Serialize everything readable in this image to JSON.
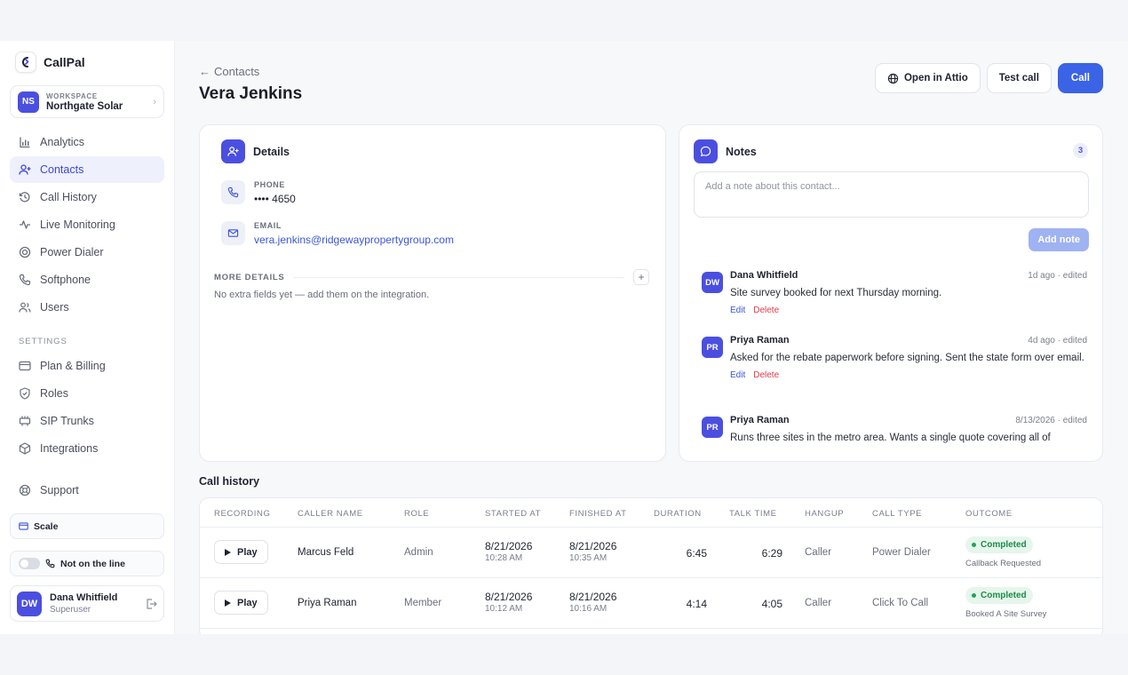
{
  "brand": {
    "name": "CallPal"
  },
  "workspace": {
    "badge": "NS",
    "label": "WORKSPACE",
    "name": "Northgate Solar"
  },
  "nav": [
    {
      "label": "Analytics",
      "icon": "bar-chart-icon"
    },
    {
      "label": "Contacts",
      "icon": "user-plus-icon",
      "active": true
    },
    {
      "label": "Call History",
      "icon": "history-icon"
    },
    {
      "label": "Live Monitoring",
      "icon": "activity-icon"
    },
    {
      "label": "Power Dialer",
      "icon": "target-icon"
    },
    {
      "label": "Softphone",
      "icon": "phone-icon"
    },
    {
      "label": "Users",
      "icon": "users-icon"
    }
  ],
  "settings_label": "SETTINGS",
  "settings_nav": [
    {
      "label": "Plan & Billing",
      "icon": "credit-card-icon"
    },
    {
      "label": "Roles",
      "icon": "shield-icon"
    },
    {
      "label": "SIP Trunks",
      "icon": "server-icon"
    },
    {
      "label": "Integrations",
      "icon": "cube-icon"
    }
  ],
  "support": {
    "label": "Support",
    "icon": "lifebuoy-icon"
  },
  "plan": {
    "label": "Scale"
  },
  "line_status": {
    "label": "Not on the line"
  },
  "user": {
    "initials": "DW",
    "name": "Dana Whitfield",
    "role": "Superuser"
  },
  "header": {
    "back_label": "Contacts",
    "title": "Vera Jenkins",
    "open_attio": "Open in Attio",
    "test_call": "Test call",
    "call": "Call"
  },
  "details": {
    "title": "Details",
    "phone_label": "PHONE",
    "phone_value": "•••• 4650",
    "email_label": "EMAIL",
    "email_value": "vera.jenkins@ridgewaypropertygroup.com",
    "more_label": "MORE DETAILS",
    "more_empty": "No extra fields yet — add them on the integration."
  },
  "notes": {
    "title": "Notes",
    "count": "3",
    "placeholder": "Add a note about this contact...",
    "add_label": "Add note",
    "edit_label": "Edit",
    "delete_label": "Delete",
    "items": [
      {
        "initials": "DW",
        "author": "Dana Whitfield",
        "time": "1d ago · edited",
        "text": "Site survey booked for next Thursday morning."
      },
      {
        "initials": "PR",
        "author": "Priya Raman",
        "time": "4d ago · edited",
        "text": "Asked for the rebate paperwork before signing. Sent the state form over email."
      },
      {
        "initials": "PR",
        "author": "Priya Raman",
        "time": "8/13/2026 · edited",
        "text": "Runs three sites in the metro area. Wants a single quote covering all of"
      }
    ]
  },
  "call_history": {
    "title": "Call history",
    "columns": [
      "RECORDING",
      "CALLER NAME",
      "ROLE",
      "STARTED AT",
      "FINISHED AT",
      "DURATION",
      "TALK TIME",
      "HANGUP",
      "CALL TYPE",
      "OUTCOME"
    ],
    "play_label": "Play",
    "rows": [
      {
        "caller": "Marcus Feld",
        "role": "Admin",
        "start_date": "8/21/2026",
        "start_time": "10:28 AM",
        "end_date": "8/21/2026",
        "end_time": "10:35 AM",
        "duration": "6:45",
        "talk": "6:29",
        "hangup": "Caller",
        "type": "Power Dialer",
        "status": "Completed",
        "outcome": "Callback Requested"
      },
      {
        "caller": "Priya Raman",
        "role": "Member",
        "start_date": "8/21/2026",
        "start_time": "10:12 AM",
        "end_date": "8/21/2026",
        "end_time": "10:16 AM",
        "duration": "4:14",
        "talk": "4:05",
        "hangup": "Caller",
        "type": "Click To Call",
        "status": "Completed",
        "outcome": "Booked A Site Survey"
      }
    ]
  },
  "colors": {
    "accent": "#3b63e6",
    "brand": "#4b4fe0",
    "success": "#1e8a48",
    "danger": "#e03a4b"
  }
}
